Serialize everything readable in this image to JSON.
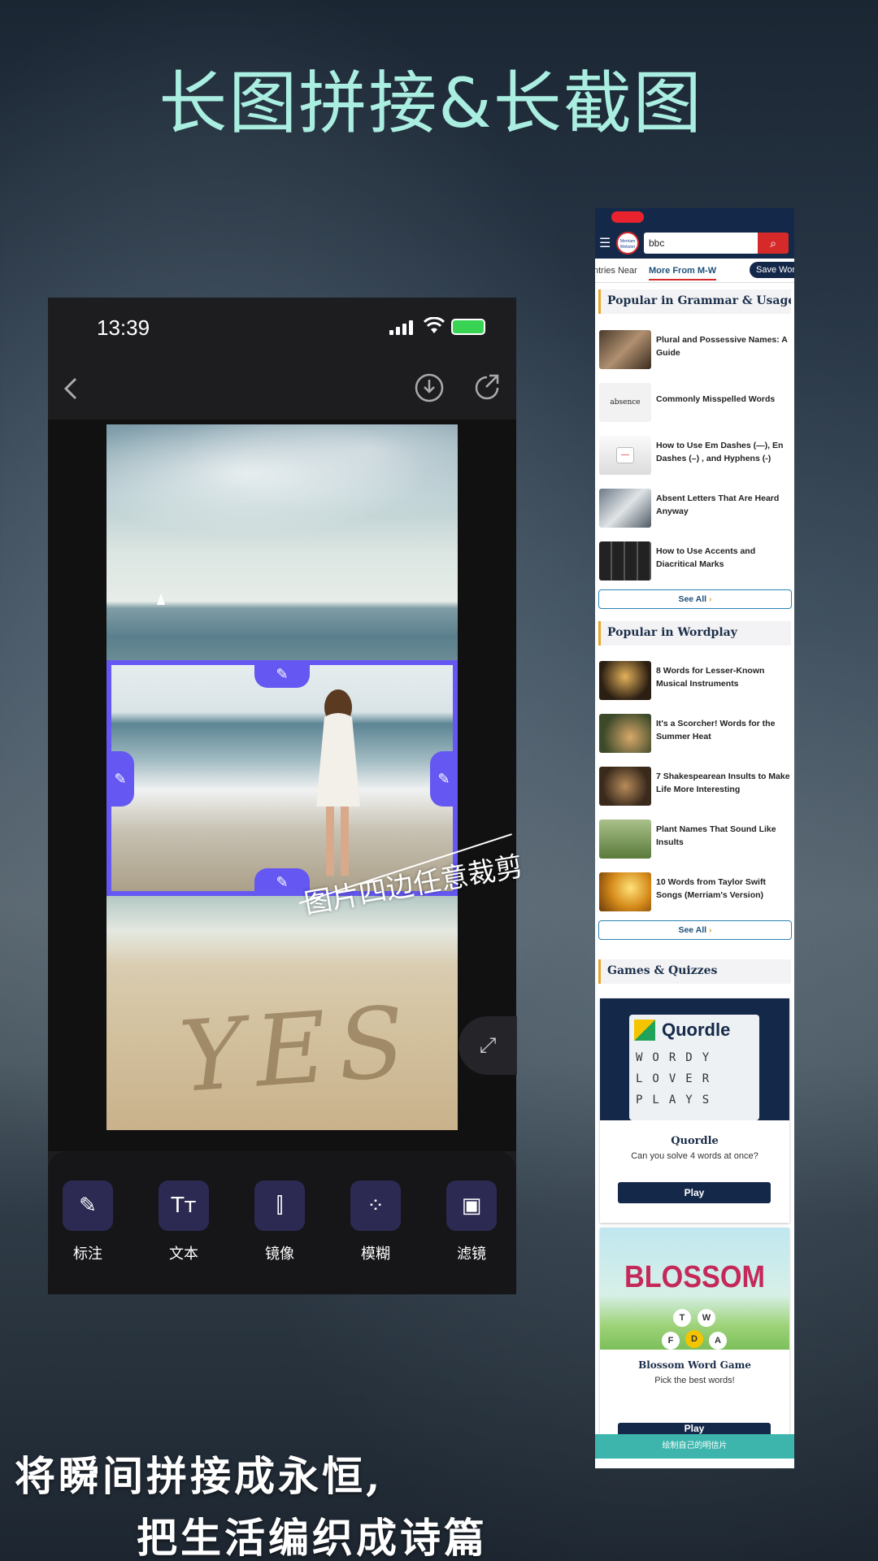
{
  "headline": "长图拼接&长截图",
  "phone": {
    "time": "13:39",
    "overlay_text": "图片四边任意裁剪",
    "tools": [
      {
        "icon": "annotate-icon",
        "glyph": "✎",
        "label": "标注"
      },
      {
        "icon": "text-icon",
        "glyph": "Tт",
        "label": "文本"
      },
      {
        "icon": "mirror-icon",
        "glyph": "⫿",
        "label": "镜像"
      },
      {
        "icon": "blur-icon",
        "glyph": "⁘",
        "label": "模糊"
      },
      {
        "icon": "filter-icon",
        "glyph": "▣",
        "label": "滤镜"
      }
    ],
    "sand_text": "YES"
  },
  "web": {
    "search_value": "bbc",
    "tabs": [
      "ntries Near",
      "More From M-W",
      "Save Wor"
    ],
    "section1": "Popular in Grammar & Usage",
    "articles1": [
      "Plural and Possessive Names: A Guide",
      "Commonly Misspelled Words",
      "How to Use Em Dashes (—), En Dashes (–) , and Hyphens (-)",
      "Absent Letters That Are Heard Anyway",
      "How to Use Accents and Diacritical Marks"
    ],
    "thumb_text": "absence",
    "see_all": "See All",
    "section2": "Popular in Wordplay",
    "articles2": [
      "8 Words for Lesser-Known Musical Instruments",
      "It's a Scorcher! Words for the Summer Heat",
      "7 Shakespearean Insults to Make Life More Interesting",
      "Plant Names That Sound Like Insults",
      "10 Words from Taylor Swift Songs (Merriam's Version)"
    ],
    "section3": "Games & Quizzes",
    "game1": {
      "logo": "Quordle",
      "title": "Quordle",
      "desc": "Can you solve 4 words at once?",
      "play": "Play"
    },
    "quordle_rows": [
      "WORDY",
      "LOVER",
      "PLAYS"
    ],
    "game2": {
      "logo": "BLOSSOM",
      "title": "Blossom Word Game",
      "desc": "Pick the best words!",
      "play": "Play"
    },
    "blossom_letters": [
      "T",
      "W",
      "F",
      "D",
      "A"
    ],
    "banner": "绘制自己的明信片"
  },
  "poem": {
    "line1": "将瞬间拼接成永恒,",
    "line2": "把生活编织成诗篇"
  },
  "colors": {
    "accent": "#6457f2",
    "headline": "#a9eee0",
    "mw_navy": "#14294a",
    "mw_red": "#d62a2a"
  }
}
